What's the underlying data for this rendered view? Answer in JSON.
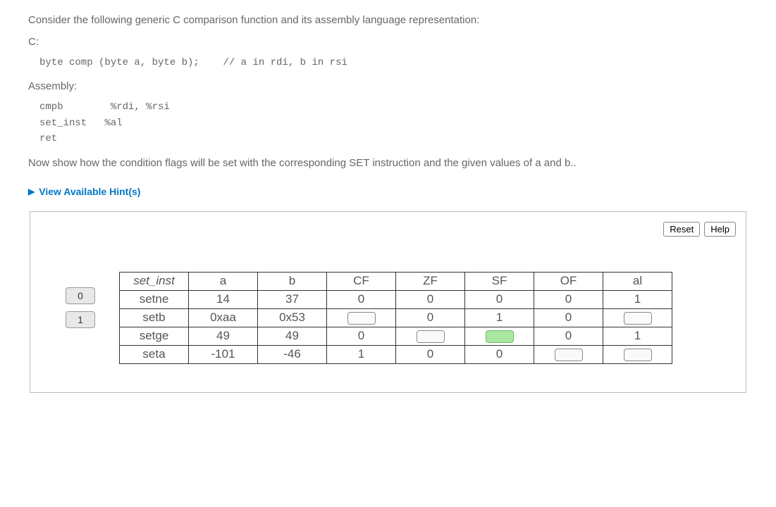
{
  "intro": "Consider the following generic C comparison function and its assembly language representation:",
  "c_label": "C:",
  "c_code": "byte comp (byte a, byte b);    // a in rdi, b in rsi",
  "asm_label": "Assembly:",
  "asm_code": "cmpb        %rdi, %rsi\nset_inst   %al\nret",
  "instruction": "Now show how the condition flags will be set with the corresponding SET instruction and the given values of a and b..",
  "hint_label": "View Available Hint(s)",
  "buttons": {
    "reset": "Reset",
    "help": "Help"
  },
  "tiles": [
    "0",
    "1"
  ],
  "headers": [
    "set_inst",
    "a",
    "b",
    "CF",
    "ZF",
    "SF",
    "OF",
    "al"
  ],
  "rows": [
    {
      "set_inst": "setne",
      "a": "14",
      "b": "37",
      "CF": "0",
      "ZF": "0",
      "SF": "0",
      "OF": "0",
      "al": "1"
    },
    {
      "set_inst": "setb",
      "a": "0xaa",
      "b": "0x53",
      "CF": "",
      "ZF": "0",
      "SF": "1",
      "OF": "0",
      "al": ""
    },
    {
      "set_inst": "setge",
      "a": "49",
      "b": "49",
      "CF": "0",
      "ZF": "",
      "SF": "",
      "OF": "0",
      "al": "1"
    },
    {
      "set_inst": "seta",
      "a": "-101",
      "b": "-46",
      "CF": "1",
      "ZF": "0",
      "SF": "0",
      "OF": "",
      "al": ""
    }
  ],
  "blank_highlight": {
    "row": 2,
    "col": "SF"
  }
}
